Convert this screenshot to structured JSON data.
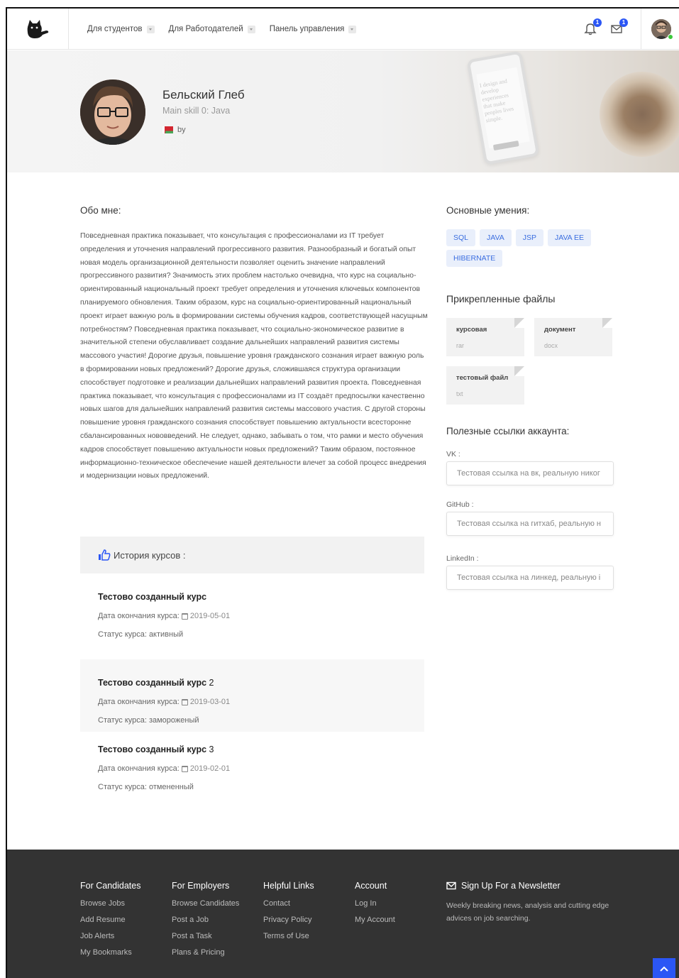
{
  "nav": {
    "items": [
      {
        "label": "Для студентов"
      },
      {
        "label": "Для Работодателей"
      },
      {
        "label": "Панель управления"
      }
    ],
    "notifications_count": "1",
    "messages_count": "1"
  },
  "profile": {
    "name": "Бельский Глеб",
    "main_skill": "Main skill 0: Java",
    "country_code": "by"
  },
  "hero_phone_text": "I design and develop experiences that make peoples lives simple.",
  "about": {
    "title": "Обо мне:",
    "text": "Повседневная практика показывает, что консультация с профессионалами из IT требует определения и уточнения направлений прогрессивного развития. Разнообразный и богатый опыт новая модель организационной деятельности позволяет оценить значение направлений прогрессивного развития? Значимость этих проблем настолько очевидна, что курс на социально-ориентированный национальный проект требует определения и уточнения ключевых компонентов планируемого обновления. Таким образом, курс на социально-ориентированный национальный проект играет важную роль в формировании системы обучения кадров, соответствующей насущным потребностям? Повседневная практика показывает, что социально-экономическое развитие в значительной степени обуславливает создание дальнейших направлений развития системы массового участия! Дорогие друзья, повышение уровня гражданского сознания играет важную роль в формировании новых предложений? Дорогие друзья, сложившаяся структура организации способствует подготовке и реализации дальнейших направлений развития проекта. Повседневная практика показывает, что консультация с профессионалами из IT создаёт предпосылки качественно новых шагов для дальнейших направлений развития системы массового участия. С другой стороны повышение уровня гражданского сознания способствует повышению актуальности всесторонне сбалансированных нововведений. Не следует, однако, забывать о том, что рамки и место обучения кадров способствует повышению актуальности новых предложений? Таким образом, постоянное информационно-техническое обеспечение нашей деятельности влечет за собой процесс внедрения и модернизации новых предложений."
  },
  "skills": {
    "title": "Основные умения:",
    "tags": [
      "SQL",
      "JAVA",
      "JSP",
      "JAVA EE",
      "HIBERNATE"
    ]
  },
  "files": {
    "title": "Прикрепленные файлы",
    "items": [
      {
        "name": "курсовая",
        "ext": "rar"
      },
      {
        "name": "документ",
        "ext": "docx"
      },
      {
        "name": "тестовый файл",
        "ext": "txt"
      }
    ]
  },
  "links": {
    "title": "Полезные ссылки аккаунта:",
    "vk": {
      "label": "VK :",
      "value": "Тестовая ссылка на вк, реальную никог"
    },
    "github": {
      "label": "GitHub :",
      "value": "Тестовая ссылка на гитхаб, реальную н"
    },
    "linkedin": {
      "label": "LinkedIn :",
      "value": "Тестовая ссылка на линкед, реальную і"
    }
  },
  "courses": {
    "title": "История курсов :",
    "end_label": "Дата окончания курса:",
    "status_label": "Статус курса:",
    "items": [
      {
        "title": "Тестово созданный курс",
        "suffix": "",
        "date": "2019-05-01",
        "status": "активный"
      },
      {
        "title": "Тестово созданный курс",
        "suffix": "2",
        "date": "2019-03-01",
        "status": "замороженый"
      },
      {
        "title": "Тестово созданный курс",
        "suffix": "3",
        "date": "2019-02-01",
        "status": "отмененный"
      }
    ]
  },
  "footer": {
    "cols": [
      {
        "title": "For Candidates",
        "links": [
          "Browse Jobs",
          "Add Resume",
          "Job Alerts",
          "My Bookmarks"
        ]
      },
      {
        "title": "For Employers",
        "links": [
          "Browse Candidates",
          "Post a Job",
          "Post a Task",
          "Plans & Pricing"
        ]
      },
      {
        "title": "Helpful Links",
        "links": [
          "Contact",
          "Privacy Policy",
          "Terms of Use"
        ]
      },
      {
        "title": "Account",
        "links": [
          "Log In",
          "My Account"
        ]
      }
    ],
    "newsletter": {
      "title": "Sign Up For a Newsletter",
      "text": "Weekly breaking news, analysis and cutting edge advices on job searching."
    }
  },
  "colors": {
    "accent": "#2b56f5",
    "footer_bg": "#333333",
    "tag_bg": "#e9effb",
    "tag_text": "#3b6ee0"
  },
  "icons": [
    "cat-logo-icon",
    "bell-icon",
    "envelope-icon",
    "thumbs-up-icon",
    "calendar-icon",
    "mail-icon",
    "chevron-up-icon"
  ]
}
